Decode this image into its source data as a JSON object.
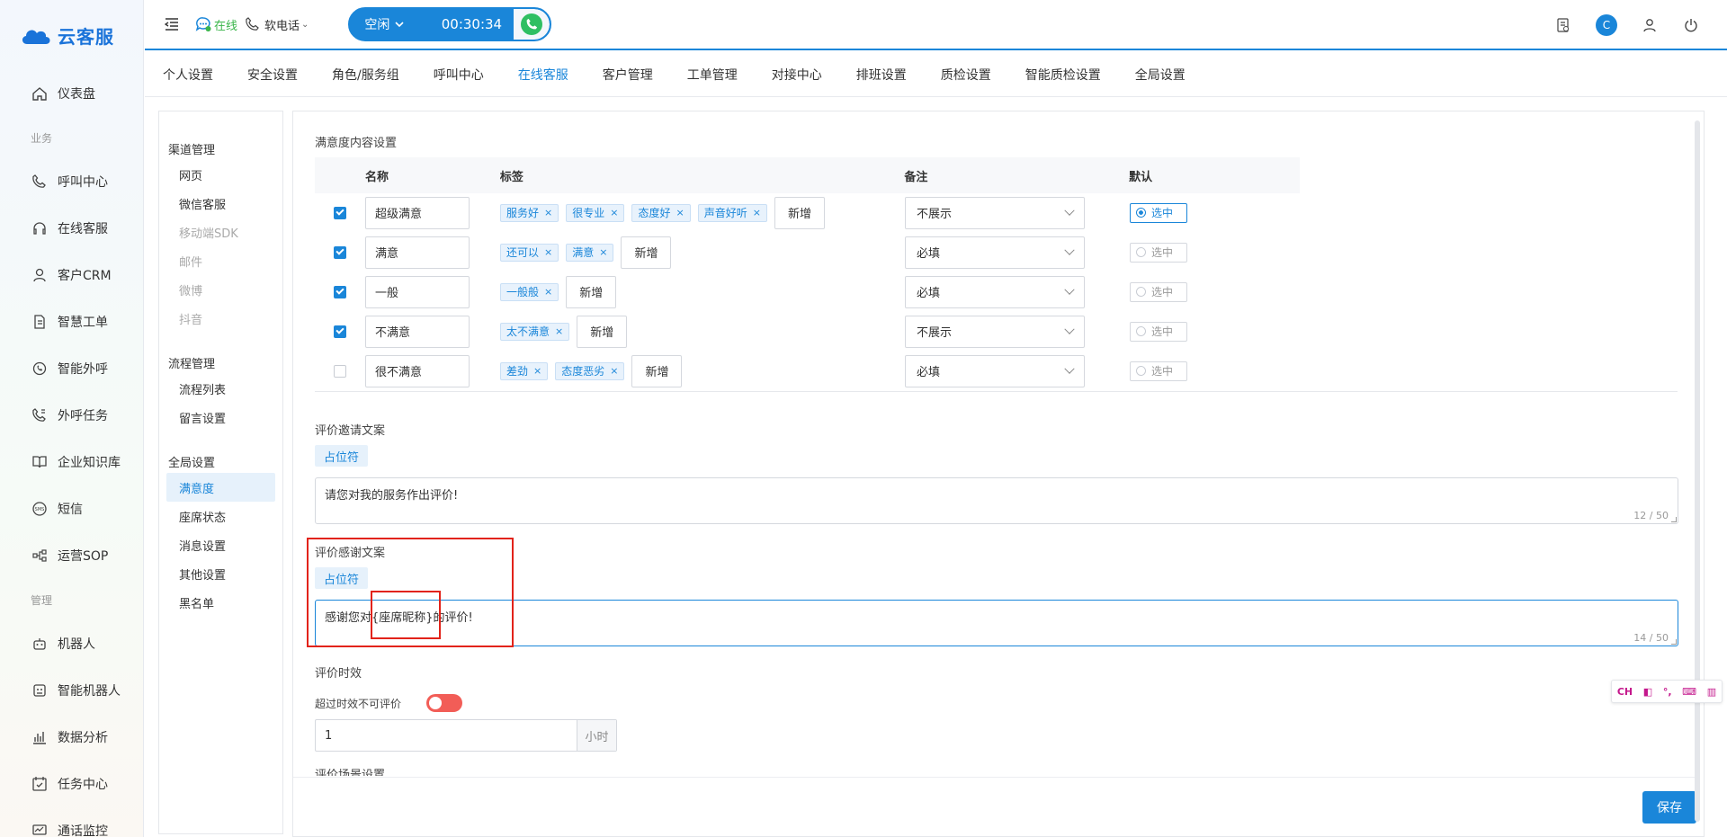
{
  "app": {
    "logo_text": "云客服",
    "brand_color": "#1a86d9"
  },
  "leftnav": {
    "items_top": [
      {
        "label": "仪表盘",
        "icon": "home-icon"
      }
    ],
    "group_business": "业务",
    "items_business": [
      {
        "label": "呼叫中心",
        "icon": "phone-icon"
      },
      {
        "label": "在线客服",
        "icon": "headset-icon"
      },
      {
        "label": "客户CRM",
        "icon": "user-icon"
      },
      {
        "label": "智慧工单",
        "icon": "document-icon"
      },
      {
        "label": "智能外呼",
        "icon": "whatsapp-icon"
      },
      {
        "label": "外呼任务",
        "icon": "phone-task-icon"
      },
      {
        "label": "企业知识库",
        "icon": "book-icon"
      },
      {
        "label": "短信",
        "icon": "sms-icon"
      },
      {
        "label": "运营SOP",
        "icon": "flow-icon"
      }
    ],
    "group_manage": "管理",
    "items_manage": [
      {
        "label": "机器人",
        "icon": "robot-icon"
      },
      {
        "label": "智能机器人",
        "icon": "smart-robot-icon"
      },
      {
        "label": "数据分析",
        "icon": "chart-icon"
      },
      {
        "label": "任务中心",
        "icon": "calendar-check-icon"
      },
      {
        "label": "通话监控",
        "icon": "monitor-icon"
      }
    ]
  },
  "topbar": {
    "online": "在线",
    "softphone": "软电话",
    "call_state": "空闲",
    "call_timer": "00:30:34",
    "avatar_letter": "C"
  },
  "tabs": [
    {
      "label": "个人设置",
      "active": false
    },
    {
      "label": "安全设置",
      "active": false
    },
    {
      "label": "角色/服务组",
      "active": false
    },
    {
      "label": "呼叫中心",
      "active": false
    },
    {
      "label": "在线客服",
      "active": true
    },
    {
      "label": "客户管理",
      "active": false
    },
    {
      "label": "工单管理",
      "active": false
    },
    {
      "label": "对接中心",
      "active": false
    },
    {
      "label": "排班设置",
      "active": false
    },
    {
      "label": "质检设置",
      "active": false
    },
    {
      "label": "智能质检设置",
      "active": false
    },
    {
      "label": "全局设置",
      "active": false
    }
  ],
  "subnav": {
    "channel_group": "渠道管理",
    "channel_items": [
      {
        "label": "网页",
        "disabled": false
      },
      {
        "label": "微信客服",
        "disabled": false
      },
      {
        "label": "移动端SDK",
        "disabled": true
      },
      {
        "label": "邮件",
        "disabled": true
      },
      {
        "label": "微博",
        "disabled": true
      },
      {
        "label": "抖音",
        "disabled": true
      }
    ],
    "flow_group": "流程管理",
    "flow_items": [
      {
        "label": "流程列表"
      },
      {
        "label": "留言设置"
      }
    ],
    "global_group": "全局设置",
    "global_items": [
      {
        "label": "满意度",
        "active": true
      },
      {
        "label": "座席状态",
        "active": false
      },
      {
        "label": "消息设置",
        "active": false
      },
      {
        "label": "其他设置",
        "active": false
      },
      {
        "label": "黑名单",
        "active": false
      }
    ]
  },
  "satisfaction": {
    "section_title": "满意度内容设置",
    "columns": {
      "name": "名称",
      "tags": "标签",
      "note": "备注",
      "default": "默认"
    },
    "add_label": "新增",
    "default_label": "选中",
    "rows": [
      {
        "checked": true,
        "name": "超级满意",
        "tags": [
          "服务好",
          "很专业",
          "态度好",
          "声音好听"
        ],
        "note": "不展示",
        "default": true
      },
      {
        "checked": true,
        "name": "满意",
        "tags": [
          "还可以",
          "满意"
        ],
        "note": "必填",
        "default": false
      },
      {
        "checked": true,
        "name": "一般",
        "tags": [
          "一般般"
        ],
        "note": "必填",
        "default": false
      },
      {
        "checked": true,
        "name": "不满意",
        "tags": [
          "太不满意"
        ],
        "note": "不展示",
        "default": false
      },
      {
        "checked": false,
        "name": "很不满意",
        "tags": [
          "差劲",
          "态度恶劣"
        ],
        "note": "必填",
        "default": false
      }
    ]
  },
  "invite": {
    "title": "评价邀请文案",
    "placeholder_btn": "占位符",
    "text": "请您对我的服务作出评价!",
    "count": "12 / 50"
  },
  "thanks": {
    "title": "评价感谢文案",
    "placeholder_btn": "占位符",
    "text": "感谢您对{座席昵称}的评价!",
    "count": "14 / 50"
  },
  "timeliness": {
    "title": "评价时效",
    "switch_label": "超过时效不可评价",
    "value": "1",
    "unit": "小时"
  },
  "scene_title_cut": "评价场景设置",
  "save_label": "保存",
  "ime": {
    "lang": "CH"
  }
}
